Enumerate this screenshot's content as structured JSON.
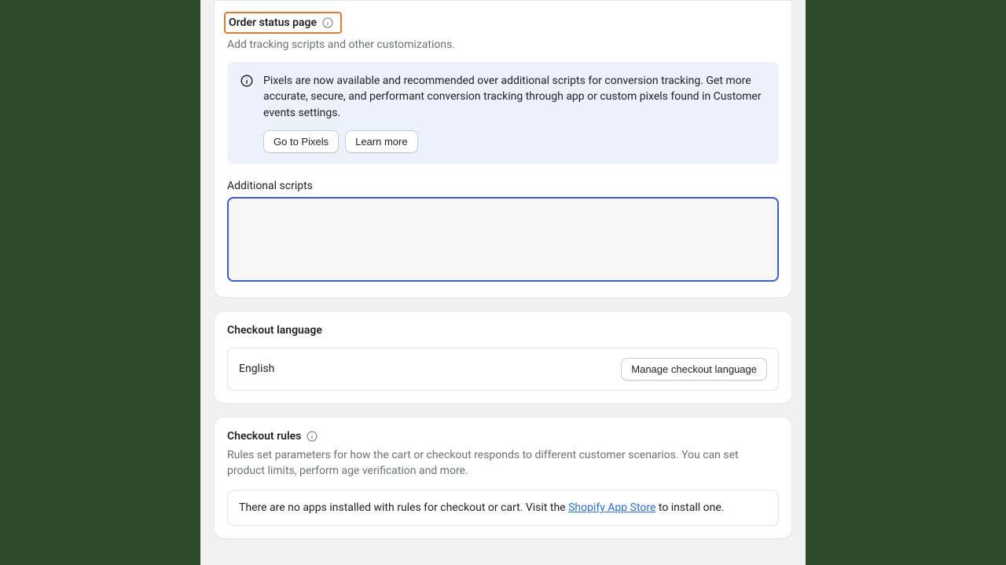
{
  "orderStatus": {
    "title": "Order status page",
    "subtitle": "Add tracking scripts and other customizations.",
    "banner": {
      "text": "Pixels are now available and recommended over additional scripts for conversion tracking. Get more accurate, secure, and performant conversion tracking through app or custom pixels found in Customer events settings.",
      "primaryBtn": "Go to Pixels",
      "secondaryBtn": "Learn more"
    },
    "scriptsLabel": "Additional scripts",
    "scriptsValue": ""
  },
  "checkoutLanguage": {
    "title": "Checkout language",
    "value": "English",
    "manageBtn": "Manage checkout language"
  },
  "checkoutRules": {
    "title": "Checkout rules",
    "desc": "Rules set parameters for how the cart or checkout responds to different customer scenarios. You can set product limits, perform age verification and more.",
    "emptyPrefix": "There are no apps installed with rules for checkout or cart. Visit the ",
    "emptyLink": "Shopify App Store",
    "emptySuffix": " to install one."
  }
}
